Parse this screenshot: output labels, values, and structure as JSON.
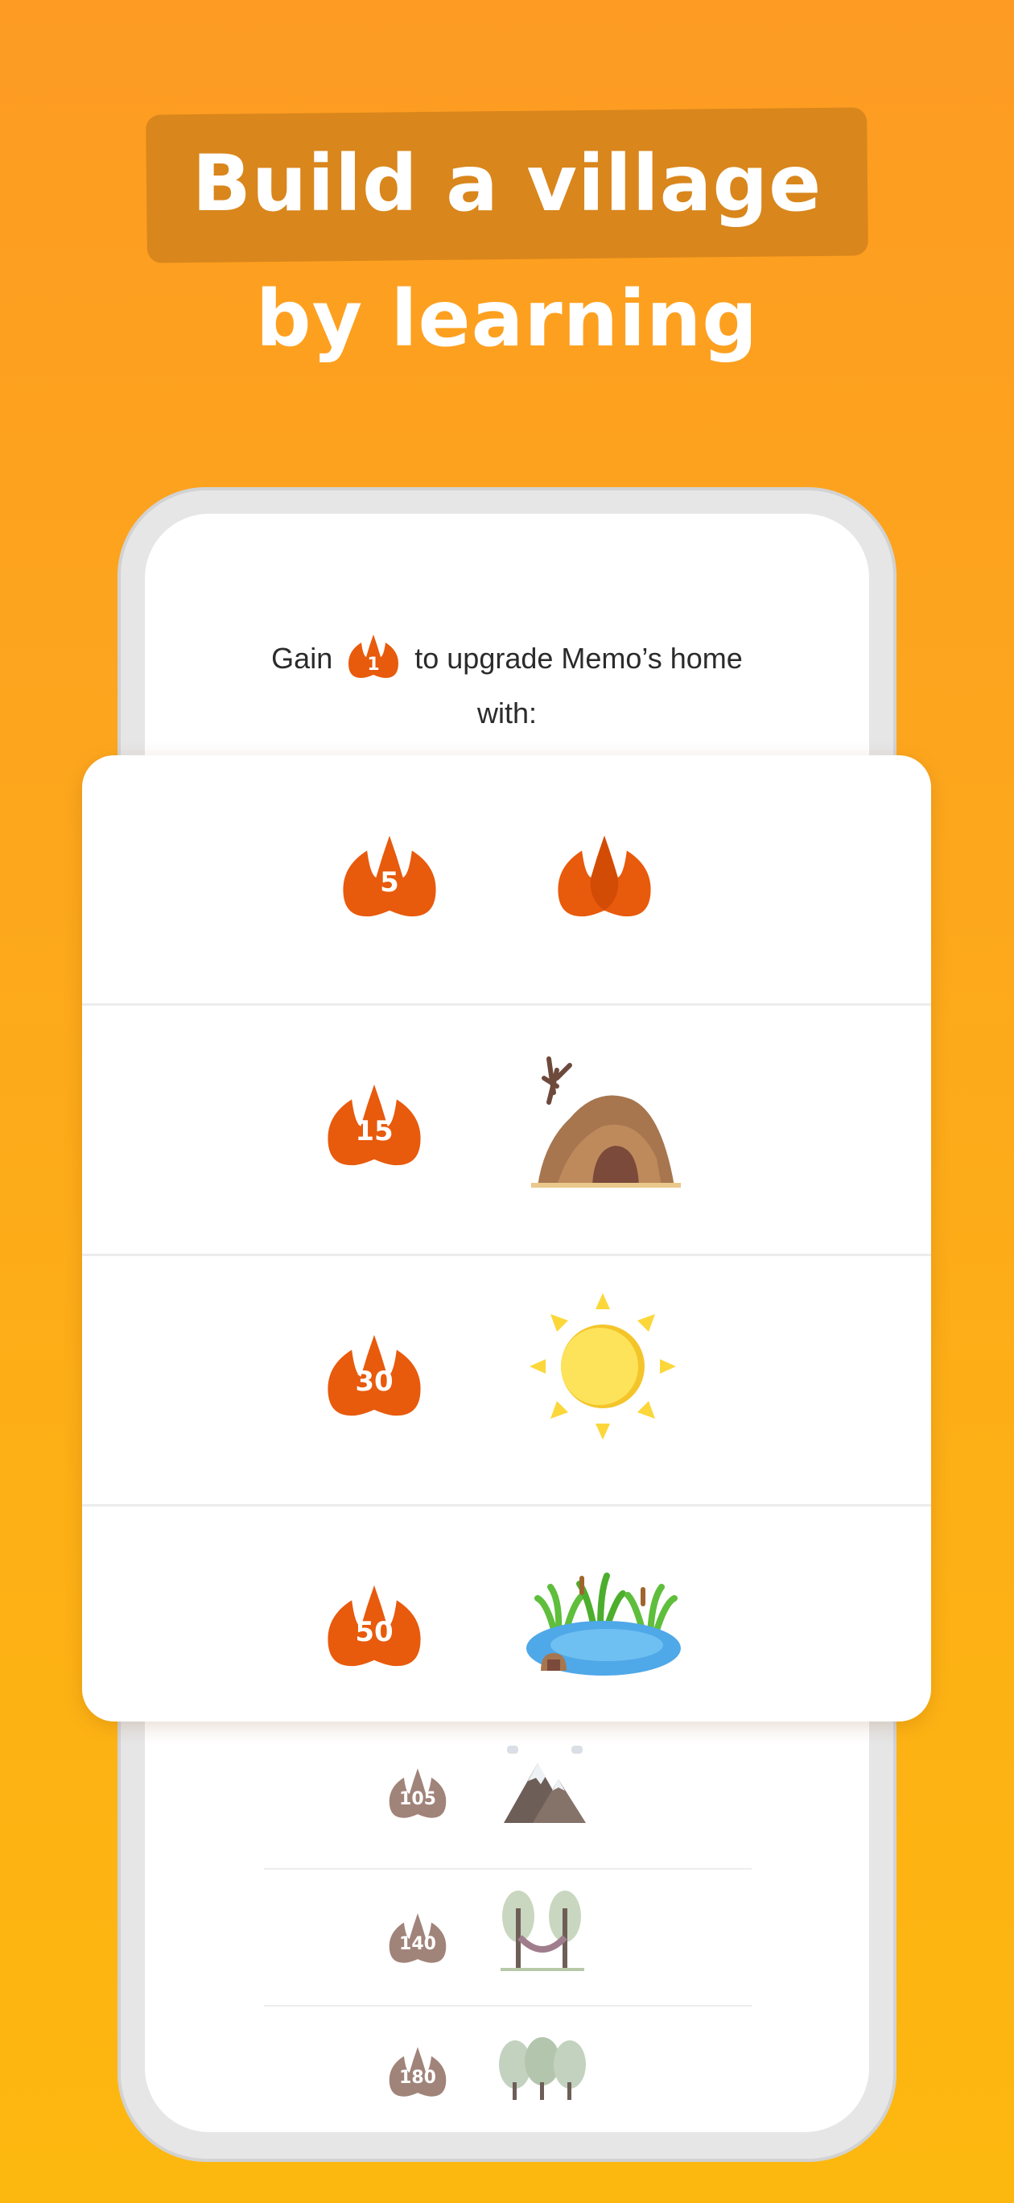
{
  "headline": {
    "line1": "Build a village",
    "line2": "by learning"
  },
  "gain": {
    "prefix": "Gain",
    "drop_value": "1",
    "suffix": "to upgrade Memo’s home",
    "line2": "with:"
  },
  "rewards": [
    {
      "cost": "5",
      "reward_icon": "drops-icon"
    },
    {
      "cost": "15",
      "reward_icon": "cave-icon"
    },
    {
      "cost": "30",
      "reward_icon": "sun-icon"
    },
    {
      "cost": "50",
      "reward_icon": "pond-icon"
    }
  ],
  "locked_rewards": [
    {
      "cost": "105",
      "reward_icon": "mountains-icon"
    },
    {
      "cost": "140",
      "reward_icon": "hammock-icon"
    },
    {
      "cost": "180",
      "reward_icon": "forest-icon"
    }
  ],
  "colors": {
    "background_top": "#FD9B22",
    "background_bottom": "#FDB80F",
    "drop_orange": "#E85A0C",
    "drop_locked": "#A08379"
  }
}
